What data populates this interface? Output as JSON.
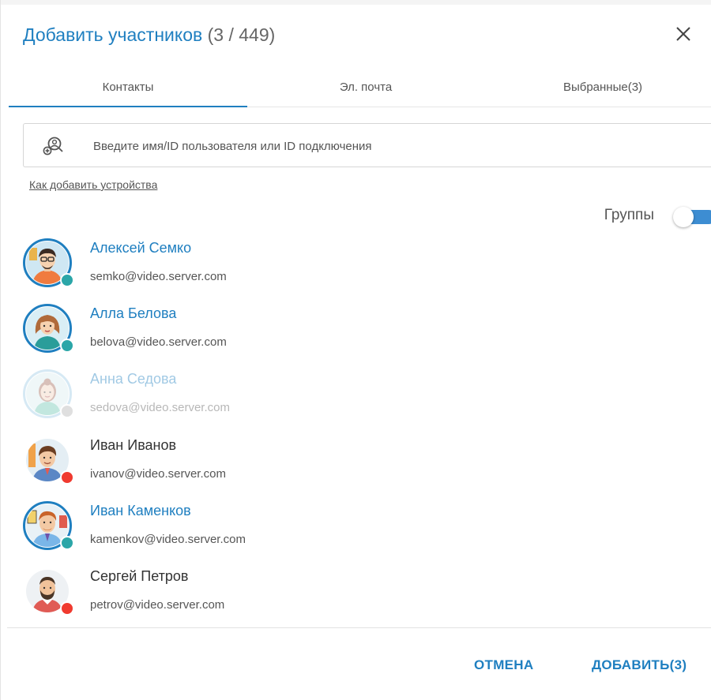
{
  "dialog": {
    "title": "Добавить участников",
    "count": "(3 / 449)"
  },
  "tabs": [
    {
      "label": "Контакты",
      "active": true
    },
    {
      "label": "Эл. почта",
      "active": false
    },
    {
      "label": "Выбранные(3)",
      "active": false
    }
  ],
  "search": {
    "placeholder": "Введите имя/ID пользователя или ID подключения",
    "value": ""
  },
  "howto_link": "Как добавить устройства",
  "groups": {
    "label": "Группы",
    "enabled": true
  },
  "contacts": [
    {
      "name": "Алексей Семко",
      "email": "semko@video.server.com",
      "selected": true,
      "status": "online",
      "dimmed": false
    },
    {
      "name": "Алла Белова",
      "email": "belova@video.server.com",
      "selected": true,
      "status": "online",
      "dimmed": false
    },
    {
      "name": "Анна Седова",
      "email": "sedova@video.server.com",
      "selected": false,
      "status": "offline",
      "dimmed": true
    },
    {
      "name": "Иван Иванов",
      "email": "ivanov@video.server.com",
      "selected": false,
      "status": "busy",
      "dimmed": false
    },
    {
      "name": "Иван Каменков",
      "email": "kamenkov@video.server.com",
      "selected": true,
      "status": "online",
      "dimmed": false
    },
    {
      "name": "Сергей Петров",
      "email": "petrov@video.server.com",
      "selected": false,
      "status": "busy",
      "dimmed": false
    }
  ],
  "footer": {
    "cancel_label": "ОТМЕНА",
    "add_label": "ДОБАВИТЬ(3)"
  },
  "colors": {
    "accent": "#1f7fc0",
    "online": "#2ba6a8",
    "busy": "#f03a2f",
    "offline": "#b5b5b5"
  },
  "icons": {
    "close": "close-icon",
    "search": "search-user-icon"
  }
}
